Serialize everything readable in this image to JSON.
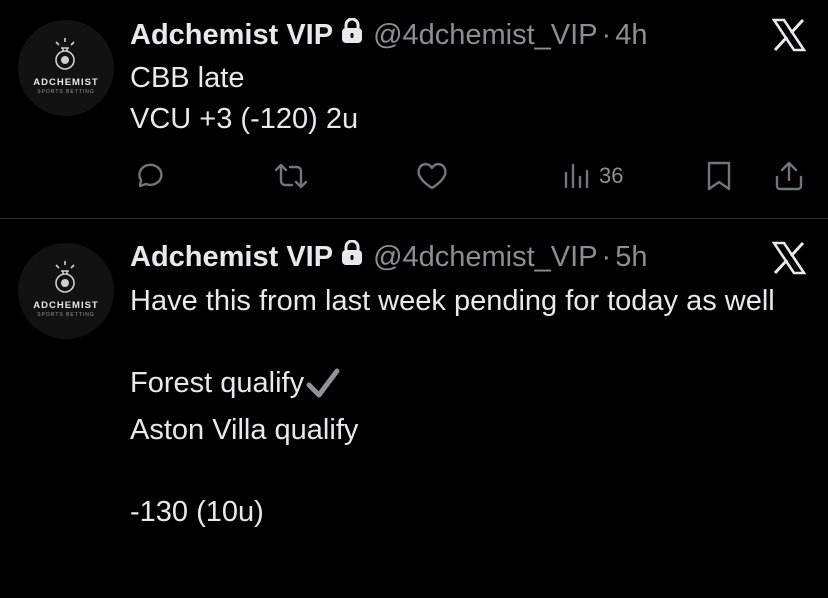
{
  "tweets": [
    {
      "author": "Adchemist VIP",
      "handle": "@4dchemist_VIP",
      "separator": "·",
      "time": "4h",
      "text": "CBB late\nVCU +3 (-120) 2u",
      "views": "36",
      "avatar": {
        "brand": "ADCHEMIST",
        "tagline": "SPORTS BETTING"
      }
    },
    {
      "author": "Adchemist VIP",
      "handle": "@4dchemist_VIP",
      "separator": "·",
      "time": "5h",
      "text_lines": [
        "Have this from last week pending for today as well",
        "",
        "Forest qualify",
        "Aston Villa qualify",
        "",
        "-130 (10u)"
      ],
      "avatar": {
        "brand": "ADCHEMIST",
        "tagline": "SPORTS BETTING"
      }
    }
  ],
  "icons": {
    "lock": "lock-icon",
    "x_logo": "x-logo-icon",
    "reply": "reply-icon",
    "repost": "repost-icon",
    "like": "heart-icon",
    "views": "views-icon",
    "bookmark": "bookmark-icon",
    "share": "share-icon",
    "check": "checkmark-icon"
  },
  "colors": {
    "background": "#000000",
    "text": "#e7e9ea",
    "muted": "#71767b"
  }
}
